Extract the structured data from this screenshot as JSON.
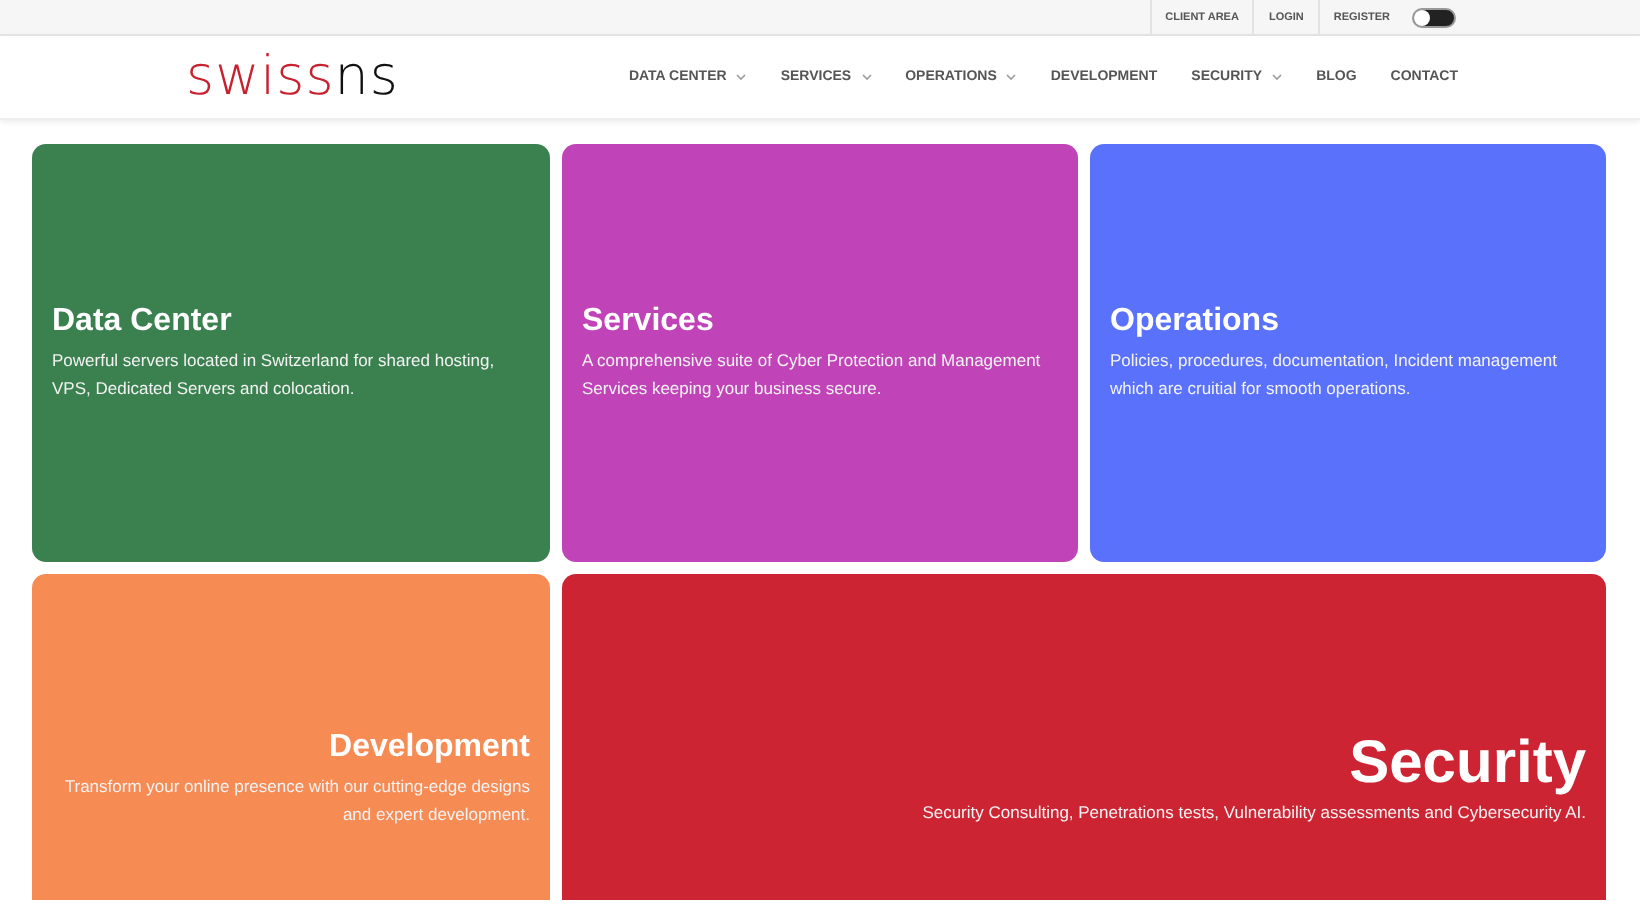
{
  "top_bar": {
    "links": [
      "CLIENT AREA",
      "LOGIN",
      "REGISTER"
    ],
    "dark_mode": false
  },
  "header": {
    "logo": {
      "primary": "swiss",
      "secondary": "ns"
    },
    "nav": [
      {
        "label": "DATA CENTER",
        "dropdown": true
      },
      {
        "label": "SERVICES",
        "dropdown": true
      },
      {
        "label": "OPERATIONS",
        "dropdown": true
      },
      {
        "label": "DEVELOPMENT",
        "dropdown": false
      },
      {
        "label": "SECURITY",
        "dropdown": true
      },
      {
        "label": "BLOG",
        "dropdown": false
      },
      {
        "label": "CONTACT",
        "dropdown": false
      }
    ]
  },
  "cards": [
    {
      "title": "Data Center",
      "text": "Powerful servers located in Switzerland for shared hosting, VPS, Dedicated Servers and colocation.",
      "color": "#3b8150",
      "kind": "standard"
    },
    {
      "title": "Services",
      "text": "A comprehensive suite of Cyber Protection and Management Services keeping your business secure.",
      "color": "#c044b8",
      "kind": "standard"
    },
    {
      "title": "Operations",
      "text": "Policies, procedures, documentation, Incident management which are cruitial for smooth operations.",
      "color": "#5a72fb",
      "kind": "standard"
    },
    {
      "title": "Development",
      "text": "Transform your online presence with our cutting-edge designs and expert development.",
      "color": "#f68b54",
      "kind": "aligned"
    },
    {
      "title": "Security",
      "text": "Security Consulting, Penetrations tests, Vulnerability assessments and Cybersecurity AI.",
      "color": "#cd2433",
      "kind": "feature"
    }
  ]
}
